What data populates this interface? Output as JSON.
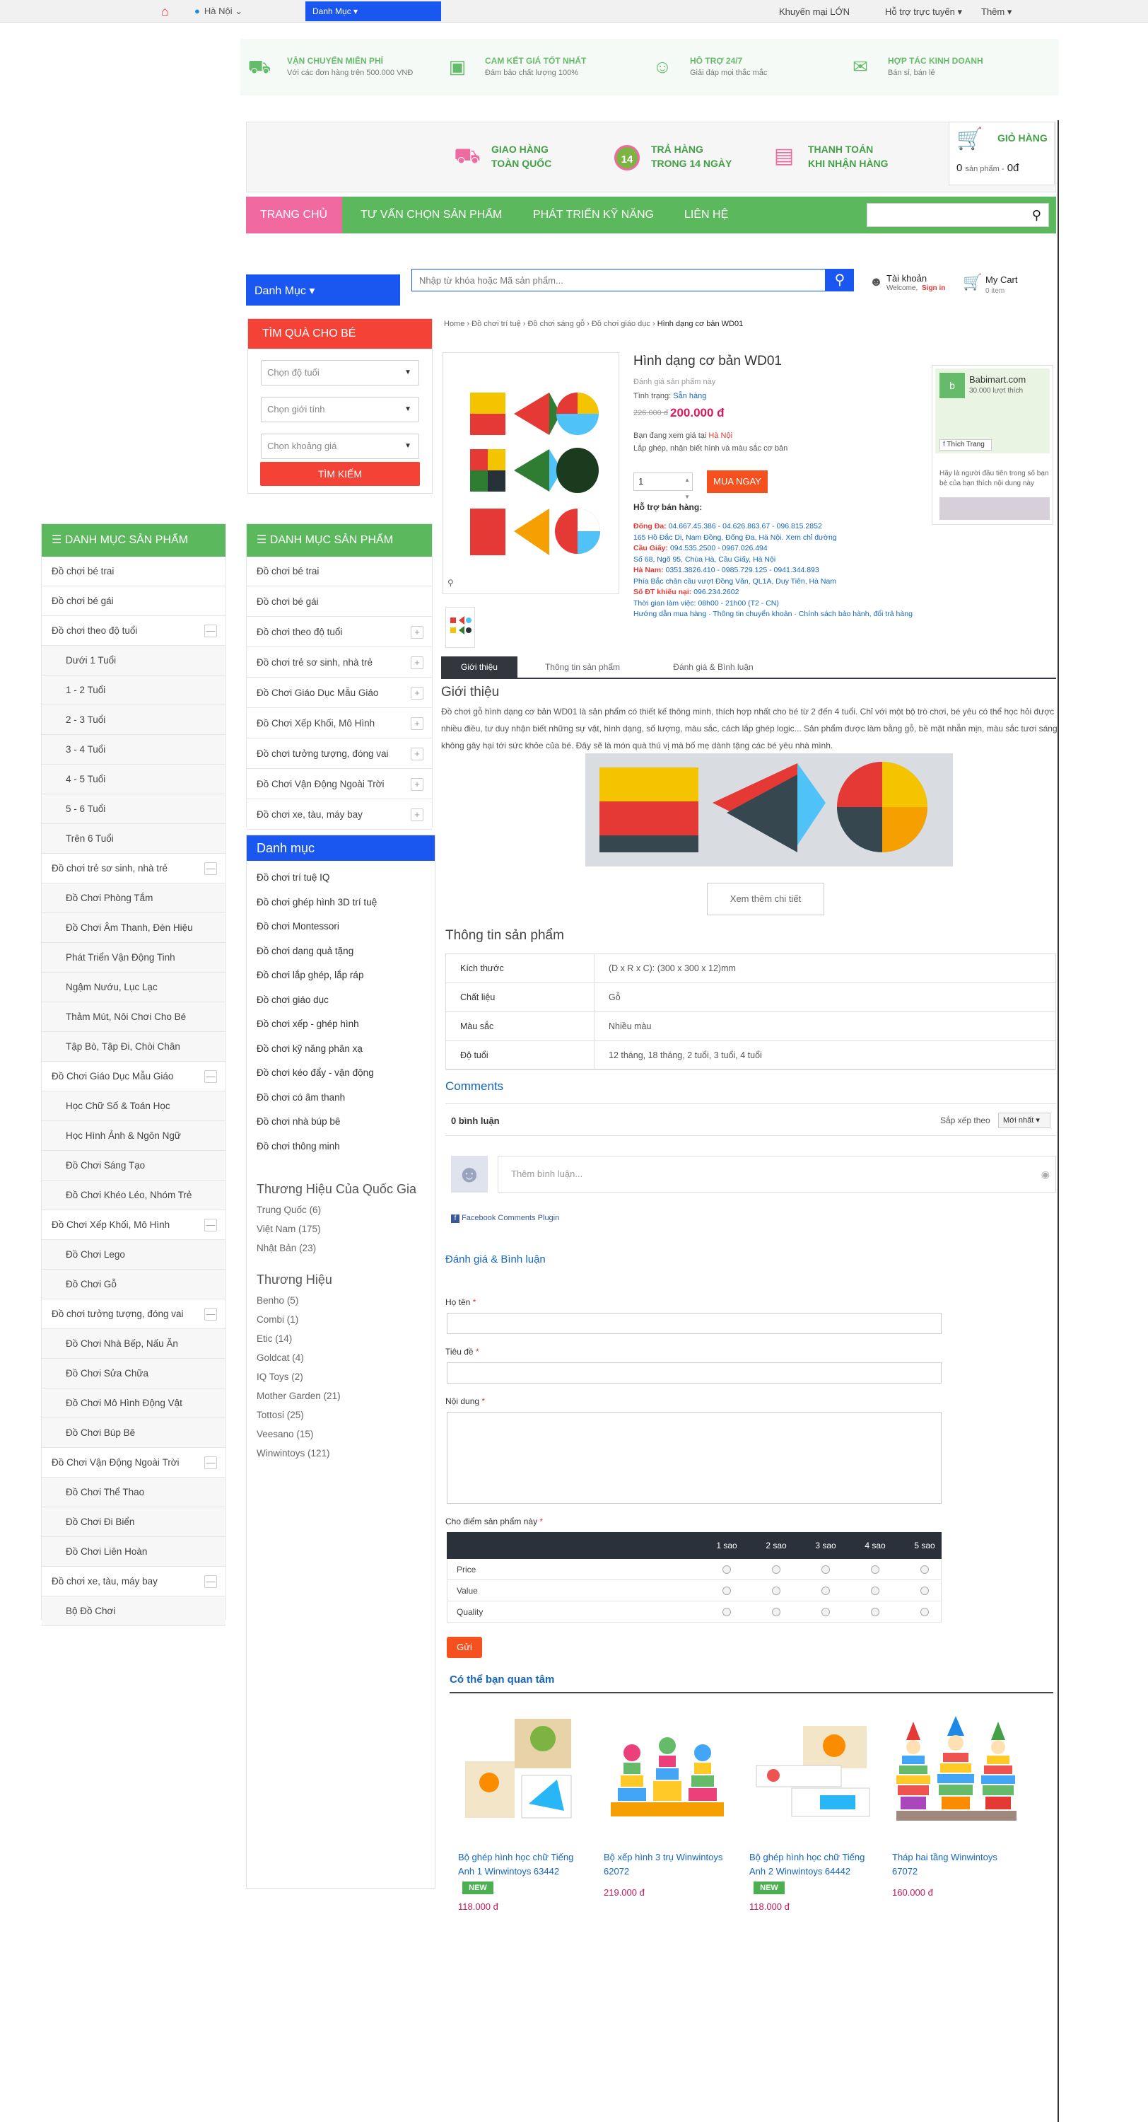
{
  "topbar": {
    "location": "Hà Nội",
    "category_dropdown": "Danh Mục",
    "promo": "Khuyến mại LỚN",
    "support": "Hỗ trợ trực tuyến",
    "more": "Thêm"
  },
  "services": [
    {
      "title": "VẬN CHUYỂN MIỄN PHÍ",
      "sub": "Với các đơn hàng trên 500.000 VNĐ"
    },
    {
      "title": "CAM KẾT GIÁ TỐT NHẤT",
      "sub": "Đảm bảo chất lượng 100%"
    },
    {
      "title": "HỖ TRỢ 24/7",
      "sub": "Giải đáp mọi thắc mắc"
    },
    {
      "title": "HỢP TÁC KINH DOANH",
      "sub": "Bán sỉ, bán lẻ"
    }
  ],
  "header": {
    "items": [
      {
        "l1": "GIAO HÀNG",
        "l2": "TOÀN QUỐC"
      },
      {
        "l1": "TRẢ HÀNG",
        "l2": "TRONG 14 NGÀY"
      },
      {
        "l1": "THANH TOÁN",
        "l2": "KHI NHẬN HÀNG"
      }
    ],
    "return_badge": "14",
    "cart_title": "GIỎ HÀNG",
    "cart_count": "0",
    "cart_label": "sản phẩm -",
    "cart_total": "0đ"
  },
  "nav": [
    "TRANG CHỦ",
    "TƯ VẤN CHỌN SẢN PHẨM",
    "PHÁT TRIỂN KỸ NĂNG",
    "LIÊN HỆ"
  ],
  "searchrow": {
    "dm": "Danh Mục",
    "placeholder": "Nhập từ khóa hoặc Mã sản phẩm...",
    "account": "Tài khoản",
    "welcome": "Welcome,",
    "signin": "Sign in",
    "mycart": "My Cart",
    "mycart_items": "0 item"
  },
  "filter": {
    "title": "TÌM QUÀ CHO BÉ",
    "age": "Chọn độ tuổi",
    "gender": "Chọn giới tính",
    "price": "Chọn khoảng giá",
    "button": "TÌM KIẾM"
  },
  "leftcat": {
    "title": "DANH MỤC SẢN PHẨM",
    "rows": [
      {
        "t": "Đồ chơi bé trai",
        "sub": false,
        "pl": ""
      },
      {
        "t": "Đồ chơi bé gái",
        "sub": false,
        "pl": ""
      },
      {
        "t": "Đồ chơi theo độ tuổi",
        "sub": false,
        "pl": "—"
      },
      {
        "t": "Dưới 1 Tuổi",
        "sub": true,
        "pl": ""
      },
      {
        "t": "1 - 2 Tuổi",
        "sub": true,
        "pl": ""
      },
      {
        "t": "2 - 3 Tuổi",
        "sub": true,
        "pl": ""
      },
      {
        "t": "3 - 4 Tuổi",
        "sub": true,
        "pl": ""
      },
      {
        "t": "4 - 5 Tuổi",
        "sub": true,
        "pl": ""
      },
      {
        "t": "5 - 6 Tuổi",
        "sub": true,
        "pl": ""
      },
      {
        "t": "Trên 6 Tuổi",
        "sub": true,
        "pl": ""
      },
      {
        "t": "Đồ chơi trẻ sơ sinh, nhà trẻ",
        "sub": false,
        "pl": "—"
      },
      {
        "t": "Đồ Chơi Phòng Tắm",
        "sub": true,
        "pl": ""
      },
      {
        "t": "Đồ Chơi Âm Thanh, Đèn Hiệu",
        "sub": true,
        "pl": ""
      },
      {
        "t": "Phát Triển Vận Động Tinh",
        "sub": true,
        "pl": ""
      },
      {
        "t": "Ngậm Nướu, Lục Lạc",
        "sub": true,
        "pl": ""
      },
      {
        "t": "Thảm Mút, Nôi Chơi Cho Bé",
        "sub": true,
        "pl": ""
      },
      {
        "t": "Tập Bò, Tập Đi, Chòi Chân",
        "sub": true,
        "pl": ""
      },
      {
        "t": "Đồ Chơi Giáo Dục Mẫu Giáo",
        "sub": false,
        "pl": "—"
      },
      {
        "t": "Học Chữ Số & Toán Học",
        "sub": true,
        "pl": ""
      },
      {
        "t": "Học Hình Ảnh & Ngôn Ngữ",
        "sub": true,
        "pl": ""
      },
      {
        "t": "Đồ Chơi Sáng Tạo",
        "sub": true,
        "pl": ""
      },
      {
        "t": "Đồ Chơi Khéo Léo, Nhóm Trẻ",
        "sub": true,
        "pl": ""
      },
      {
        "t": "Đồ Chơi Xếp Khối, Mô Hình",
        "sub": false,
        "pl": "—"
      },
      {
        "t": "Đồ Chơi Lego",
        "sub": true,
        "pl": ""
      },
      {
        "t": "Đồ Chơi Gỗ",
        "sub": true,
        "pl": ""
      },
      {
        "t": "Đồ chơi tưởng tượng, đóng vai",
        "sub": false,
        "pl": "—"
      },
      {
        "t": "Đồ Chơi Nhà Bếp, Nấu Ăn",
        "sub": true,
        "pl": ""
      },
      {
        "t": "Đồ Chơi Sửa Chữa",
        "sub": true,
        "pl": ""
      },
      {
        "t": "Đồ Chơi Mô Hình Động Vật",
        "sub": true,
        "pl": ""
      },
      {
        "t": "Đồ Chơi Búp Bê",
        "sub": true,
        "pl": ""
      },
      {
        "t": "Đồ Chơi Vận Động Ngoài Trời",
        "sub": false,
        "pl": "—"
      },
      {
        "t": "Đồ Chơi Thể Thao",
        "sub": true,
        "pl": ""
      },
      {
        "t": "Đồ Chơi Đi Biển",
        "sub": true,
        "pl": ""
      },
      {
        "t": "Đồ Chơi Liên Hoàn",
        "sub": true,
        "pl": ""
      },
      {
        "t": "Đồ chơi xe, tàu, máy bay",
        "sub": false,
        "pl": "—"
      },
      {
        "t": "Bộ Đồ Chơi",
        "sub": true,
        "pl": ""
      }
    ]
  },
  "midcat": {
    "title": "DANH MỤC SẢN PHẨM",
    "rows": [
      {
        "t": "Đồ chơi bé trai",
        "pl": ""
      },
      {
        "t": "Đồ chơi bé gái",
        "pl": ""
      },
      {
        "t": "Đồ chơi theo độ tuổi",
        "pl": "+"
      },
      {
        "t": "Đồ chơi trẻ sơ sinh, nhà trẻ",
        "pl": "+"
      },
      {
        "t": "Đồ Chơi Giáo Dục Mẫu Giáo",
        "pl": "+"
      },
      {
        "t": "Đồ Chơi Xếp Khối, Mô Hình",
        "pl": "+"
      },
      {
        "t": "Đồ chơi tưởng tượng, đóng vai",
        "pl": "+"
      },
      {
        "t": "Đồ Chơi Vận Động Ngoài Trời",
        "pl": "+"
      },
      {
        "t": "Đồ chơi xe, tàu, máy bay",
        "pl": "+"
      }
    ]
  },
  "dmlist": {
    "title": "Danh mục",
    "items": [
      "Đồ chơi trí tuệ IQ",
      "Đồ chơi ghép hình 3D trí tuệ",
      "Đồ chơi Montessori",
      "Đồ chơi dạng quả tặng",
      "Đồ chơi lắp ghép, lắp ráp",
      "Đồ chơi giáo dục",
      "Đồ chơi xếp - ghép hình",
      "Đồ chơi kỹ năng phân xạ",
      "Đồ chơi kéo đẩy - vận động",
      "Đồ chơi có âm thanh",
      "Đồ chơi nhà búp bê",
      "Đồ chơi thông minh"
    ],
    "brand_country_title": "Thương Hiệu Của Quốc Gia",
    "countries": [
      {
        "n": "Trung Quốc",
        "c": "(6)"
      },
      {
        "n": "Việt Nam",
        "c": "(175)"
      },
      {
        "n": "Nhật Bản",
        "c": "(23)"
      }
    ],
    "brand_title": "Thương Hiệu",
    "brands": [
      {
        "n": "Benho",
        "c": "(5)"
      },
      {
        "n": "Combi",
        "c": "(1)"
      },
      {
        "n": "Etic",
        "c": "(14)"
      },
      {
        "n": "Goldcat",
        "c": "(4)"
      },
      {
        "n": "IQ Toys",
        "c": "(2)"
      },
      {
        "n": "Mother Garden",
        "c": "(21)"
      },
      {
        "n": "Tottosi",
        "c": "(25)"
      },
      {
        "n": "Veesano",
        "c": "(15)"
      },
      {
        "n": "Winwintoys",
        "c": "(121)"
      }
    ]
  },
  "breadcrumb": [
    "Home",
    "Đồ chơi trí tuệ",
    "Đồ chơi sáng gỗ",
    "Đồ chơi giáo dục",
    "Hình dạng cơ bản WD01"
  ],
  "product": {
    "title": "Hình dạng cơ bản WD01",
    "review_link": "Đánh giá sản phẩm này",
    "stock_label": "Tình trạng:",
    "stock": "Sẵn hàng",
    "old_price": "226.000 đ",
    "price": "200.000 đ",
    "viewing_prefix": "Bạn đang xem giá tại",
    "viewing_city": "Hà Nội",
    "short_desc": "Lắp ghép, nhận biết hình và màu sắc cơ bản",
    "qty": "1",
    "buy": "MUA NGAY",
    "support_title": "Hỗ trợ bán hàng:",
    "support_lines": [
      {
        "label": "Đống Đa:",
        "text": "04.667.45.386 - 04.626.863.67 - 096.815.2852"
      },
      {
        "label": "",
        "text": "165 Hồ Đắc Di, Nam Đồng, Đống Đa, Hà Nội. Xem chỉ đường"
      },
      {
        "label": "Cầu Giấy:",
        "text": "094.535.2500 - 0967.026.494"
      },
      {
        "label": "",
        "text": "Số 68, Ngõ 95, Chùa Hà, Cầu Giấy, Hà Nội"
      },
      {
        "label": "Hà Nam:",
        "text": "0351.3826.410 - 0985.729.125 - 0941.344.893"
      },
      {
        "label": "",
        "text": "Phía Bắc chân cầu vượt Đồng Văn, QL1A, Duy Tiên, Hà Nam"
      },
      {
        "label": "Số ĐT khiếu nại:",
        "text": "096.234.2602"
      },
      {
        "label": "",
        "text": "Thời gian làm việc: 08h00 - 21h00 (T2 - CN)"
      },
      {
        "label": "",
        "text": "Hướng dẫn mua hàng · Thông tin chuyển khoản · Chính sách bảo hành, đổi trả hàng"
      }
    ]
  },
  "fb": {
    "name": "Babimart.com",
    "likes": "30.000 lượt thích",
    "like_btn": "Thích Trang",
    "note": "Hãy là người đầu tiên trong số bạn bè của bạn thích nội dung này"
  },
  "tabs": [
    "Giới thiệu",
    "Thông tin sản phẩm",
    "Đánh giá & Bình luận"
  ],
  "intro": {
    "title": "Giới thiệu",
    "text": "Đồ chơi gỗ hình dạng cơ bản WD01 là sản phẩm có thiết kế thông minh, thích hợp nhất cho bé từ 2 đến 4 tuổi. Chỉ với một bộ trò chơi, bé yêu có thể học hỏi được nhiều điều, tư duy nhận biết những sự vật, hình dạng, số lượng, màu sắc, cách lắp ghép logic... Sản phẩm được làm bằng gỗ, bề mặt nhẵn mịn, màu sắc tươi sáng, không gây hại tới sức khỏe của bé. Đây sẽ là món quà thú vị mà bố mẹ dành tặng các bé yêu nhà mình.",
    "more": "Xem thêm chi tiết"
  },
  "specs": {
    "title": "Thông tin sản phẩm",
    "rows": [
      {
        "k": "Kích thước",
        "v": "(D x R x C): (300 x 300 x 12)mm"
      },
      {
        "k": "Chất liệu",
        "v": "Gỗ"
      },
      {
        "k": "Màu sắc",
        "v": "Nhiều màu"
      },
      {
        "k": "Độ tuổi",
        "v": "12 tháng, 18 tháng, 2 tuổi, 3 tuổi, 4 tuổi"
      }
    ]
  },
  "comments": {
    "title": "Comments",
    "count": "0 bình luận",
    "sort_label": "Sắp xếp theo",
    "sort_value": "Mới nhất",
    "placeholder": "Thêm bình luận...",
    "plugin": "Facebook Comments Plugin"
  },
  "review": {
    "title": "Đánh giá & Bình luận",
    "name_label": "Họ tên",
    "subject_label": "Tiêu đề",
    "content_label": "Nội dung",
    "rate_label": "Cho điểm sản phẩm này",
    "cols": [
      "1 sao",
      "2 sao",
      "3 sao",
      "4 sao",
      "5 sao"
    ],
    "rows": [
      "Price",
      "Value",
      "Quality"
    ],
    "send": "Gửi"
  },
  "related": {
    "title": "Có thể bạn quan tâm",
    "items": [
      {
        "name": "Bộ ghép hình học chữ Tiếng Anh 1 Winwintoys 63442",
        "price": "118.000 đ",
        "new": "NEW"
      },
      {
        "name": "Bộ xếp hình 3 trụ Winwintoys 62072",
        "price": "219.000 đ",
        "new": ""
      },
      {
        "name": "Bộ ghép hình học chữ Tiếng Anh 2 Winwintoys 64442",
        "price": "118.000 đ",
        "new": "NEW"
      },
      {
        "name": "Tháp hai tầng Winwintoys 67072",
        "price": "160.000 đ",
        "new": ""
      }
    ]
  }
}
